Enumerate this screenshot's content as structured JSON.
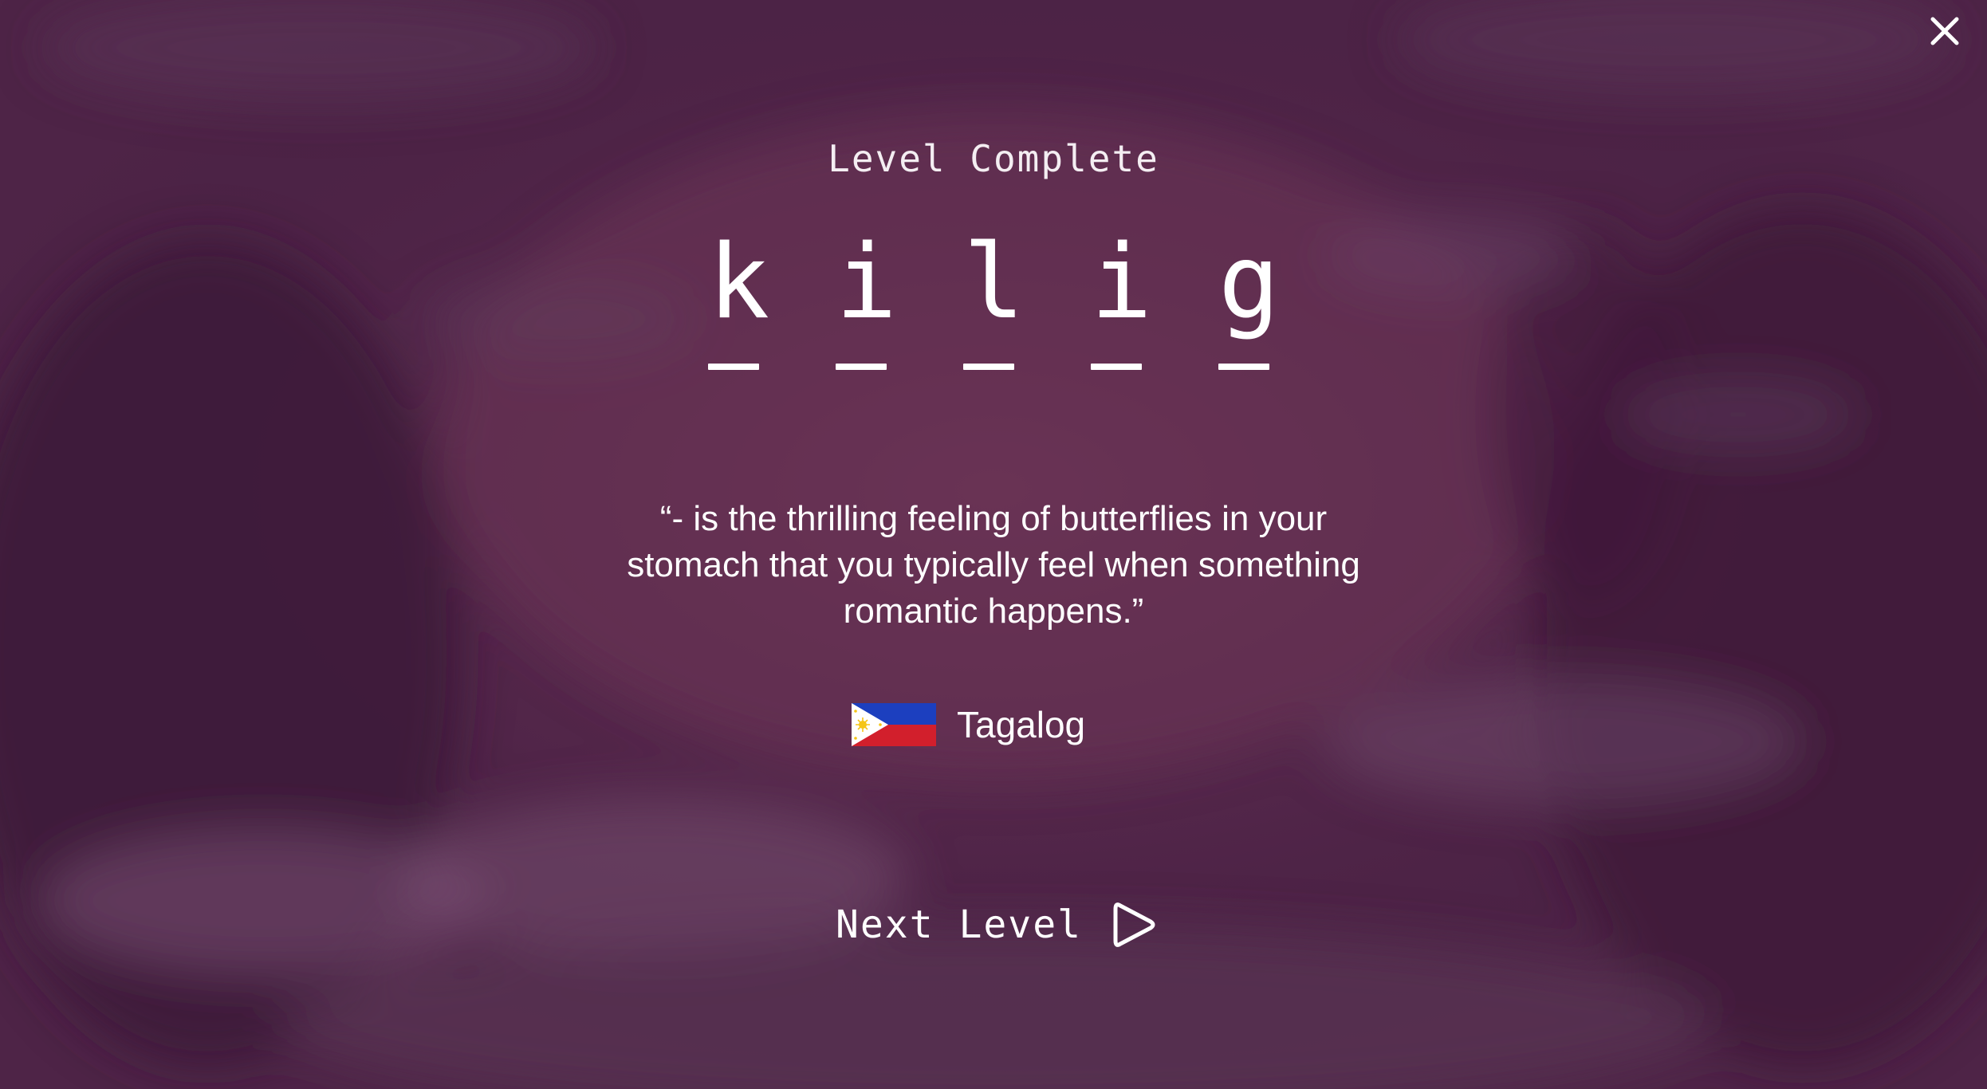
{
  "screen": {
    "title": "Level Complete",
    "word_letters": [
      "k",
      "i",
      "l",
      "i",
      "g"
    ],
    "definition": "“- is the thrilling feeling of butterflies in your stomach that you typically feel when something romantic happens.”",
    "language": {
      "name": "Tagalog",
      "flag_icon": "philippines-flag-icon"
    },
    "next_button": {
      "label": "Next Level",
      "icon": "play-icon"
    },
    "close_icon": "close-icon"
  },
  "colors": {
    "background": "#4c2346",
    "text": "#ffffff",
    "flag_blue": "#1c3fbf",
    "flag_red": "#d21f2c",
    "flag_white": "#ffffff",
    "flag_sun": "#f5c518"
  }
}
